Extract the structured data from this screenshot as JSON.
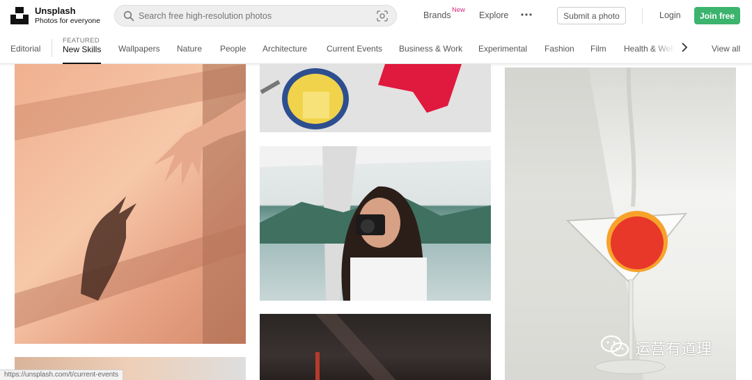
{
  "brand": {
    "name": "Unsplash",
    "tagline": "Photos for everyone"
  },
  "search": {
    "placeholder": "Search free high-resolution photos"
  },
  "nav": {
    "brands": "Brands",
    "brands_badge": "New",
    "explore": "Explore",
    "submit": "Submit a photo",
    "login": "Login",
    "join": "Join free"
  },
  "categories": {
    "first": "Editorial",
    "featured_label": "FEATURED",
    "featured_item": "New Skills",
    "items": [
      "Wallpapers",
      "Nature",
      "People",
      "Architecture",
      "Current Events",
      "Business & Work",
      "Experimental",
      "Fashion",
      "Film",
      "Health & Wellne"
    ],
    "view_all": "View all"
  },
  "status_url": "https://unsplash.com/t/current-events",
  "watermark": {
    "text": "运营有道理"
  },
  "colors": {
    "join_green": "#3cb46e",
    "new_badge": "#d6287c"
  }
}
